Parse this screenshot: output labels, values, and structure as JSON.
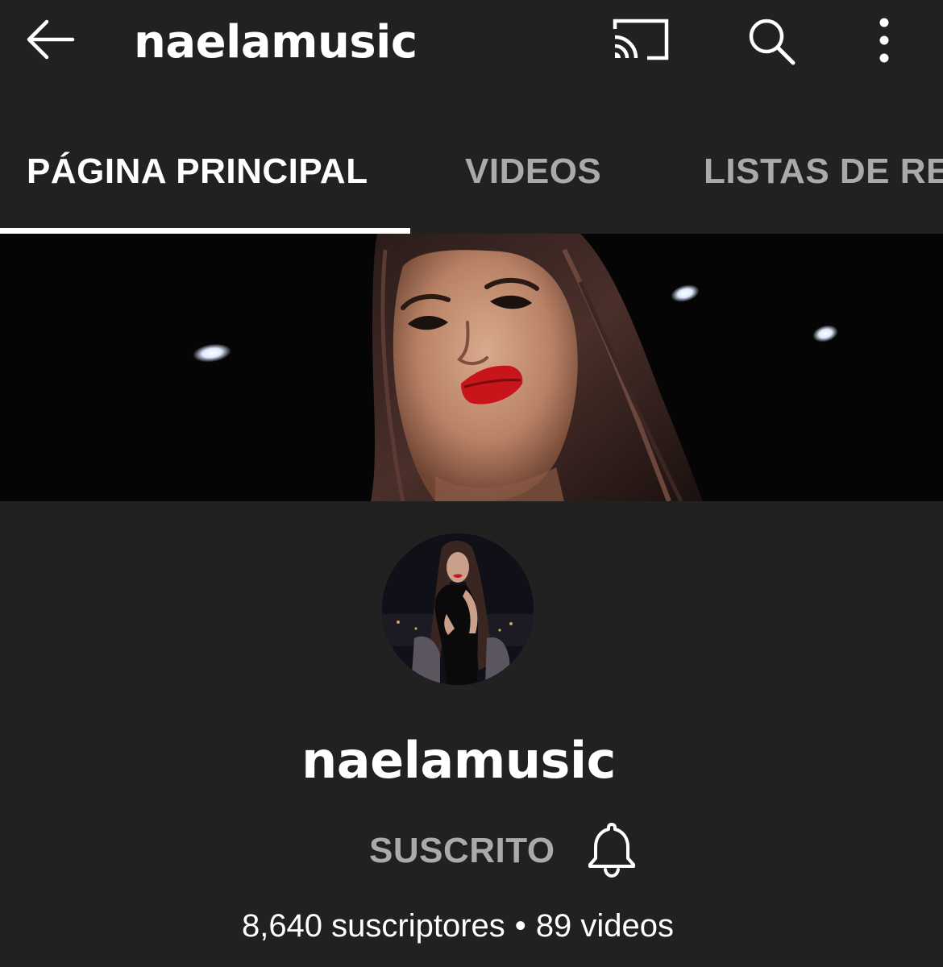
{
  "app_bar": {
    "title": "naelamusic",
    "icons": [
      "back-arrow-icon",
      "cast-icon",
      "search-icon",
      "more-vert-icon"
    ]
  },
  "tabs": [
    {
      "label": "PÁGINA PRINCIPAL",
      "selected": true
    },
    {
      "label": "VIDEOS",
      "selected": false
    },
    {
      "label": "LISTAS DE REI",
      "selected": false
    }
  ],
  "channel": {
    "name": "naelamusic",
    "subscribe_label": "SUSCRITO",
    "subscribers_text": "8,640 suscriptores",
    "separator": "•",
    "videos_text": "89 videos"
  },
  "colors": {
    "background": "#212121",
    "text_primary": "#ffffff",
    "text_secondary": "#aaaaaa",
    "lipstick": "#c8151b"
  }
}
